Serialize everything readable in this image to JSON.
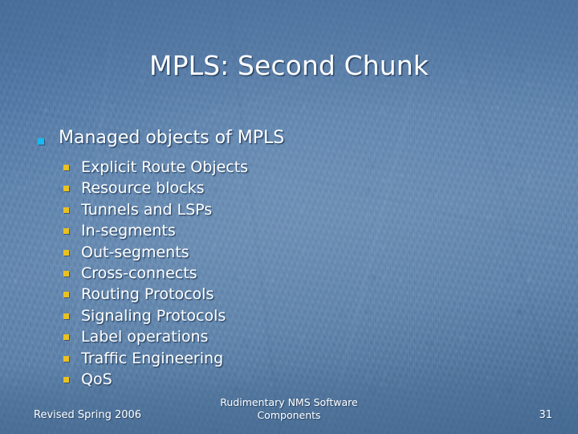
{
  "slide": {
    "title": "MPLS: Second Chunk",
    "colors": {
      "background_base": "#5a7ba6",
      "background_dark": "#3f6796",
      "background_light": "#6285ad",
      "text": "#ffffff",
      "bullet_level1": "#18b9ee",
      "bullet_level2": "#eac122"
    }
  },
  "body": {
    "level1": {
      "bullet": "square-bullet-cyan",
      "label": "Managed objects of MPLS"
    },
    "level2_bullet": "square-bullet-orange",
    "items": [
      {
        "label": "Explicit Route Objects"
      },
      {
        "label": "Resource blocks"
      },
      {
        "label": "Tunnels and LSPs"
      },
      {
        "label": "In-segments"
      },
      {
        "label": "Out-segments"
      },
      {
        "label": "Cross-connects"
      },
      {
        "label": "Routing Protocols"
      },
      {
        "label": "Signaling Protocols"
      },
      {
        "label": "Label operations"
      },
      {
        "label": "Traffic Engineering"
      },
      {
        "label": "QoS"
      }
    ]
  },
  "footer": {
    "left": "Revised Spring 2006",
    "center_line1": "Rudimentary NMS Software",
    "center_line2": "Components",
    "page_number": "31"
  }
}
